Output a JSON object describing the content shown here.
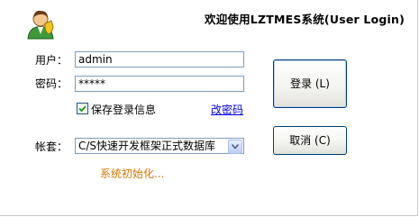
{
  "header": {
    "title": "欢迎使用LZTMES系统(User Login)"
  },
  "form": {
    "username_label": "用户：",
    "username_value": "admin",
    "password_label": "密码：",
    "password_display": "*****",
    "remember_label": "保存登录信息",
    "remember_checked": true,
    "change_password_link": "改密码",
    "account_label": "帐套：",
    "account_selected": "C/S快速开发框架正式数据库"
  },
  "buttons": {
    "login_label": "登录 (L)",
    "cancel_label": "取消 (C)"
  },
  "status": {
    "text": "系统初始化..."
  },
  "icons": {
    "avatar": "user-avatar-icon",
    "checkbox_check": "check-icon",
    "dropdown": "chevron-down-icon"
  },
  "colors": {
    "status_text": "#d77800",
    "link": "#0000ee",
    "input_border": "#7f9db9",
    "button_border": "#003c74"
  }
}
